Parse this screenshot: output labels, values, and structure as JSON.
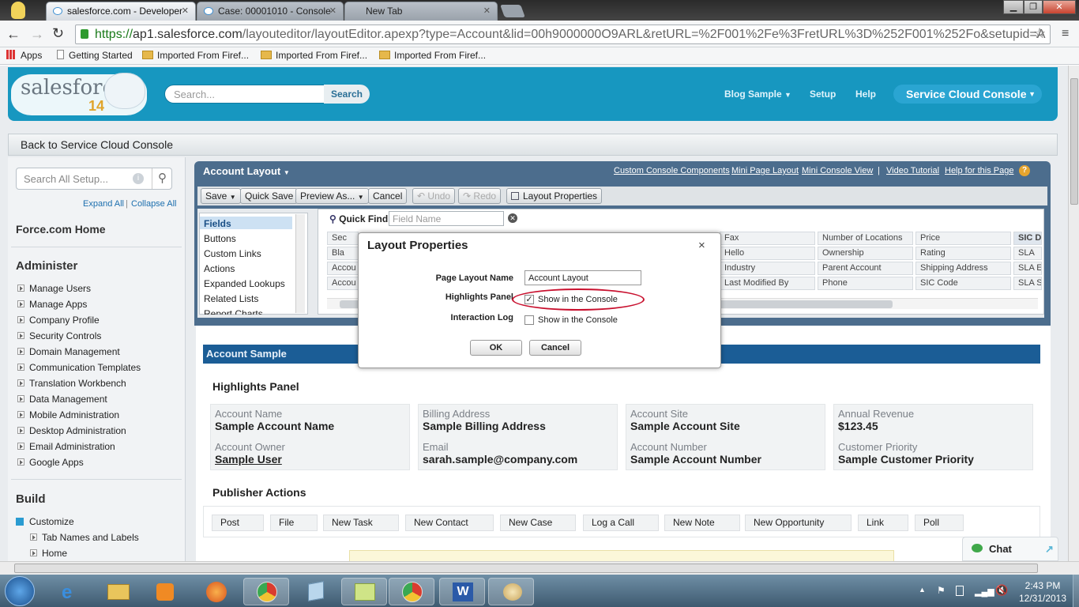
{
  "browser": {
    "tabs": [
      {
        "label": "salesforce.com - Developer"
      },
      {
        "label": "Case: 00001010 - Console"
      },
      {
        "label": "New Tab"
      }
    ],
    "url_prefix": "https://",
    "url_host": "ap1.salesforce.com",
    "url_path": "/layouteditor/layoutEditor.apexp?type=Account&lid=00h9000000O9ARL&retURL=%2F001%2Fe%3FretURL%3D%252F001%252Fo&setupid=A",
    "bookmarks": [
      "Apps",
      "Getting Started",
      "Imported From Firef...",
      "Imported From Firef...",
      "Imported From Firef..."
    ]
  },
  "header": {
    "logo_text": "salesforce",
    "logo_sub": "14",
    "search_placeholder": "Search...",
    "search_button": "Search",
    "links": [
      "Blog Sample",
      "Setup",
      "Help"
    ],
    "app_switcher": "Service Cloud Console"
  },
  "backbar": "Back to Service Cloud Console",
  "leftnav": {
    "search_placeholder": "Search All Setup...",
    "expand_all": "Expand All",
    "separator": "|",
    "collapse_all": "Collapse All",
    "home": "Force.com Home",
    "administer_heading": "Administer",
    "administer_items": [
      "Manage Users",
      "Manage Apps",
      "Company Profile",
      "Security Controls",
      "Domain Management",
      "Communication Templates",
      "Translation Workbench",
      "Data Management",
      "Mobile Administration",
      "Desktop Administration",
      "Email Administration",
      "Google Apps"
    ],
    "build_heading": "Build",
    "customize": "Customize",
    "customize_items": [
      "Tab Names and Labels",
      "Home"
    ]
  },
  "editor": {
    "title": "Account Layout",
    "links": [
      "Custom Console Components",
      "Mini Page Layout",
      "Mini Console View",
      "|",
      "Video Tutorial",
      "Help for this Page"
    ],
    "toolbar": {
      "save": "Save",
      "quick_save": "Quick Save",
      "preview_as": "Preview As...",
      "cancel": "Cancel",
      "undo": "Undo",
      "redo": "Redo",
      "layout_properties": "Layout Properties"
    },
    "palette_items": [
      "Fields",
      "Buttons",
      "Custom Links",
      "Actions",
      "Expanded Lookups",
      "Related Lists",
      "Report Charts"
    ],
    "quick_find_label": "Quick Find",
    "quick_find_placeholder": "Field Name",
    "grid_left": [
      "Sec",
      "Bla",
      "Accou",
      "Accou"
    ],
    "grid": [
      [
        "Fax",
        "Number of Locations",
        "Price",
        "SIC De"
      ],
      [
        "Hello",
        "Ownership",
        "Rating",
        "SLA"
      ],
      [
        "Industry",
        "Parent Account",
        "Shipping Address",
        "SLA E"
      ],
      [
        "Last Modified By",
        "Phone",
        "SIC Code",
        "SLA S"
      ]
    ]
  },
  "page": {
    "account_bar": "Account Sample",
    "highlights_title": "Highlights Panel",
    "highlights": [
      {
        "label": "Account Name",
        "value": "Sample Account Name"
      },
      {
        "label": "Billing Address",
        "value": "Sample Billing Address"
      },
      {
        "label": "Account Site",
        "value": "Sample Account Site"
      },
      {
        "label": "Annual Revenue",
        "value": "$123.45"
      },
      {
        "label": "Account Owner",
        "value": "Sample User"
      },
      {
        "label": "Email",
        "value": "sarah.sample@company.com"
      },
      {
        "label": "Account Number",
        "value": "Sample Account Number"
      },
      {
        "label": "Customer Priority",
        "value": "Sample Customer Priority"
      }
    ],
    "publisher_title": "Publisher Actions",
    "publisher_actions": [
      "Post",
      "File",
      "New Task",
      "New Contact",
      "New Case",
      "Log a Call",
      "New Note",
      "New Opportunity",
      "Link",
      "Poll"
    ]
  },
  "modal": {
    "title": "Layout Properties",
    "close": "×",
    "page_layout_name_label": "Page Layout Name",
    "page_layout_name_value": "Account Layout",
    "highlights_panel_label": "Highlights Panel",
    "highlights_panel_checkbox": "Show in the Console",
    "highlights_panel_checked": true,
    "interaction_log_label": "Interaction Log",
    "interaction_log_checkbox": "Show in the Console",
    "interaction_log_checked": false,
    "ok": "OK",
    "cancel": "Cancel"
  },
  "chat": "Chat",
  "taskbar": {
    "time": "2:43 PM",
    "date": "12/31/2013"
  }
}
